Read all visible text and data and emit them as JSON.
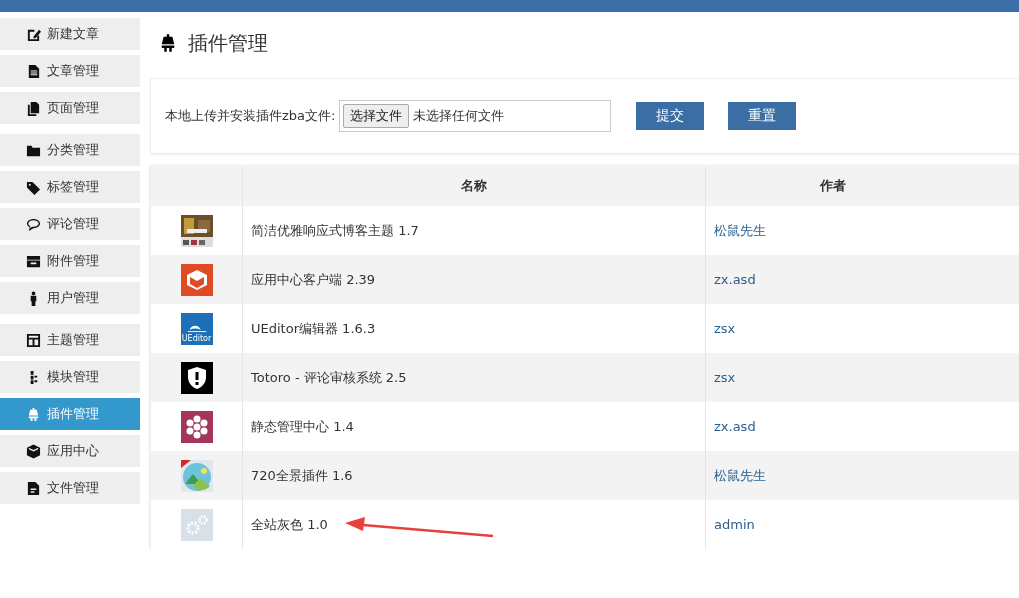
{
  "sidebar": {
    "groups": [
      {
        "items": [
          {
            "label": "新建文章",
            "kind": "edit",
            "selected": false
          },
          {
            "label": "文章管理",
            "kind": "doc",
            "selected": false
          },
          {
            "label": "页面管理",
            "kind": "page",
            "selected": false
          }
        ]
      },
      {
        "items": [
          {
            "label": "分类管理",
            "kind": "folder",
            "selected": false
          },
          {
            "label": "标签管理",
            "kind": "tag",
            "selected": false
          },
          {
            "label": "评论管理",
            "kind": "comment",
            "selected": false
          },
          {
            "label": "附件管理",
            "kind": "archive",
            "selected": false
          },
          {
            "label": "用户管理",
            "kind": "user",
            "selected": false
          }
        ]
      },
      {
        "items": [
          {
            "label": "主题管理",
            "kind": "layout",
            "selected": false
          },
          {
            "label": "模块管理",
            "kind": "module",
            "selected": false
          },
          {
            "label": "插件管理",
            "kind": "plug",
            "selected": true
          },
          {
            "label": "应用中心",
            "kind": "cube",
            "selected": false
          },
          {
            "label": "文件管理",
            "kind": "file",
            "selected": false
          }
        ]
      }
    ]
  },
  "page_title": "插件管理",
  "upload": {
    "label": "本地上传并安装插件zba文件:",
    "choose_button": "选择文件",
    "file_status": "未选择任何文件",
    "buttons": [
      "提交",
      "重置"
    ]
  },
  "table": {
    "columns": [
      "名称",
      "作者"
    ],
    "rows": [
      {
        "kind": "theme",
        "name": "简洁优雅响应式博客主题 1.7",
        "author": "松鼠先生"
      },
      {
        "kind": "box",
        "name": "应用中心客户端 2.39",
        "author": "zx.asd"
      },
      {
        "kind": "ueditor",
        "logo_text": "UEditor",
        "name": "UEditor编辑器 1.6.3",
        "author": "zsx"
      },
      {
        "kind": "shield",
        "name": "Totoro - 评论审核系统 2.5",
        "author": "zsx"
      },
      {
        "kind": "flower",
        "name": "静态管理中心 1.4",
        "author": "zx.asd"
      },
      {
        "kind": "landscape",
        "name": "720全景插件 1.6",
        "author": "松鼠先生"
      },
      {
        "kind": "gears",
        "name": "全站灰色 1.0",
        "author": "admin"
      }
    ]
  }
}
